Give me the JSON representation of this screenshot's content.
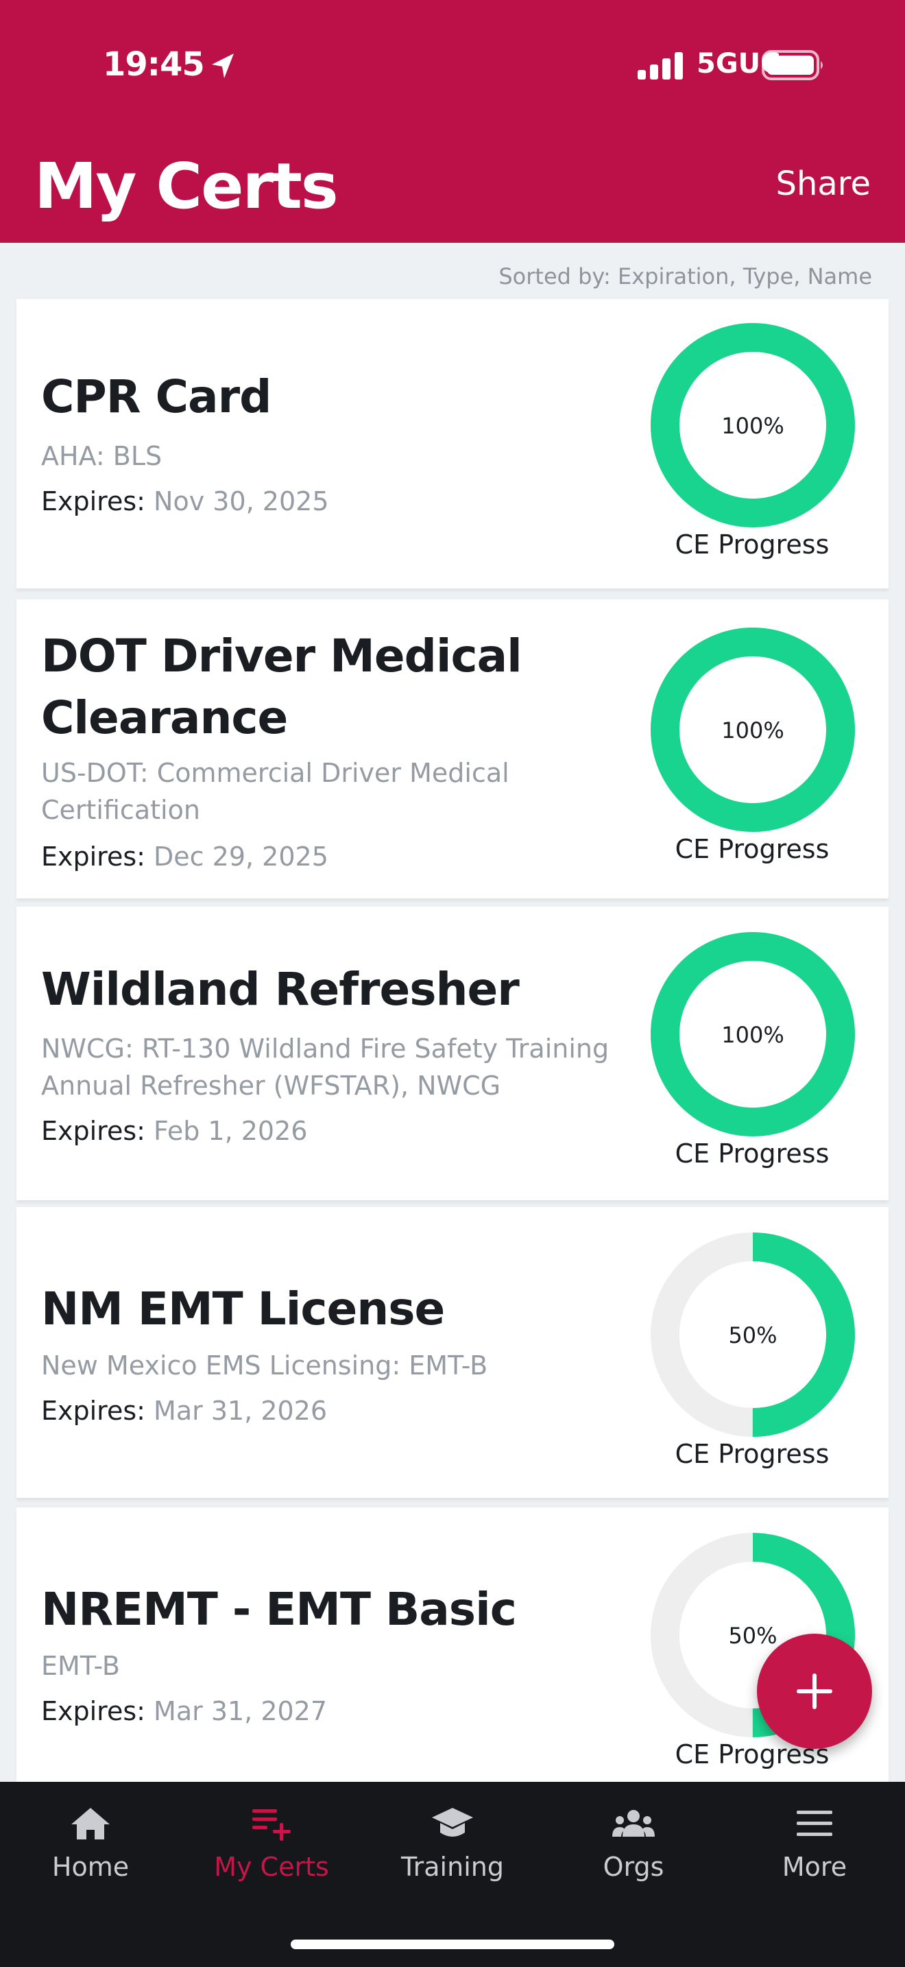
{
  "status_bar": {
    "time": "19:45",
    "network": "5GUC"
  },
  "header": {
    "title": "My Certs",
    "share_label": "Share"
  },
  "sort_note": "Sorted by: Expiration, Type, Name",
  "certs": [
    {
      "title_lines": [
        "CPR Card"
      ],
      "issuer": "AHA: BLS",
      "expires_label": "Expires:",
      "expires": "Nov 30, 2025",
      "progress": 100,
      "progress_label": "100%",
      "caption": "CE Progress"
    },
    {
      "title_lines": [
        "DOT Driver Medical",
        "Clearance"
      ],
      "issuer": "US-DOT: Commercial Driver Medical Certification",
      "expires_label": "Expires:",
      "expires": "Dec 29, 2025",
      "progress": 100,
      "progress_label": "100%",
      "caption": "CE Progress"
    },
    {
      "title_lines": [
        "Wildland Refresher"
      ],
      "issuer": "NWCG: RT-130 Wildland Fire Safety Training Annual Refresher (WFSTAR), NWCG",
      "expires_label": "Expires:",
      "expires": "Feb 1, 2026",
      "progress": 100,
      "progress_label": "100%",
      "caption": "CE Progress"
    },
    {
      "title_lines": [
        "NM EMT License"
      ],
      "issuer": "New Mexico EMS Licensing: EMT-B",
      "expires_label": "Expires:",
      "expires": "Mar 31, 2026",
      "progress": 50,
      "progress_label": "50%",
      "caption": "CE Progress"
    },
    {
      "title_lines": [
        "NREMT - EMT Basic"
      ],
      "issuer": "EMT-B",
      "expires_label": "Expires:",
      "expires": "Mar 31, 2027",
      "progress": 50,
      "progress_label": "50%",
      "caption": "CE Progress"
    }
  ],
  "fab": {
    "icon": "plus-icon"
  },
  "tabs": [
    {
      "label": "Home",
      "icon": "home-icon"
    },
    {
      "label": "My Certs",
      "icon": "certs-list-icon",
      "active": true
    },
    {
      "label": "Training",
      "icon": "graduation-cap-icon"
    },
    {
      "label": "Orgs",
      "icon": "people-group-icon"
    },
    {
      "label": "More",
      "icon": "menu-icon"
    }
  ],
  "colors": {
    "brand": "#bb1148",
    "accent_active": "#c41649",
    "progress": "#19d48e",
    "track": "#eeeeee",
    "tabbar": "#15171b"
  }
}
